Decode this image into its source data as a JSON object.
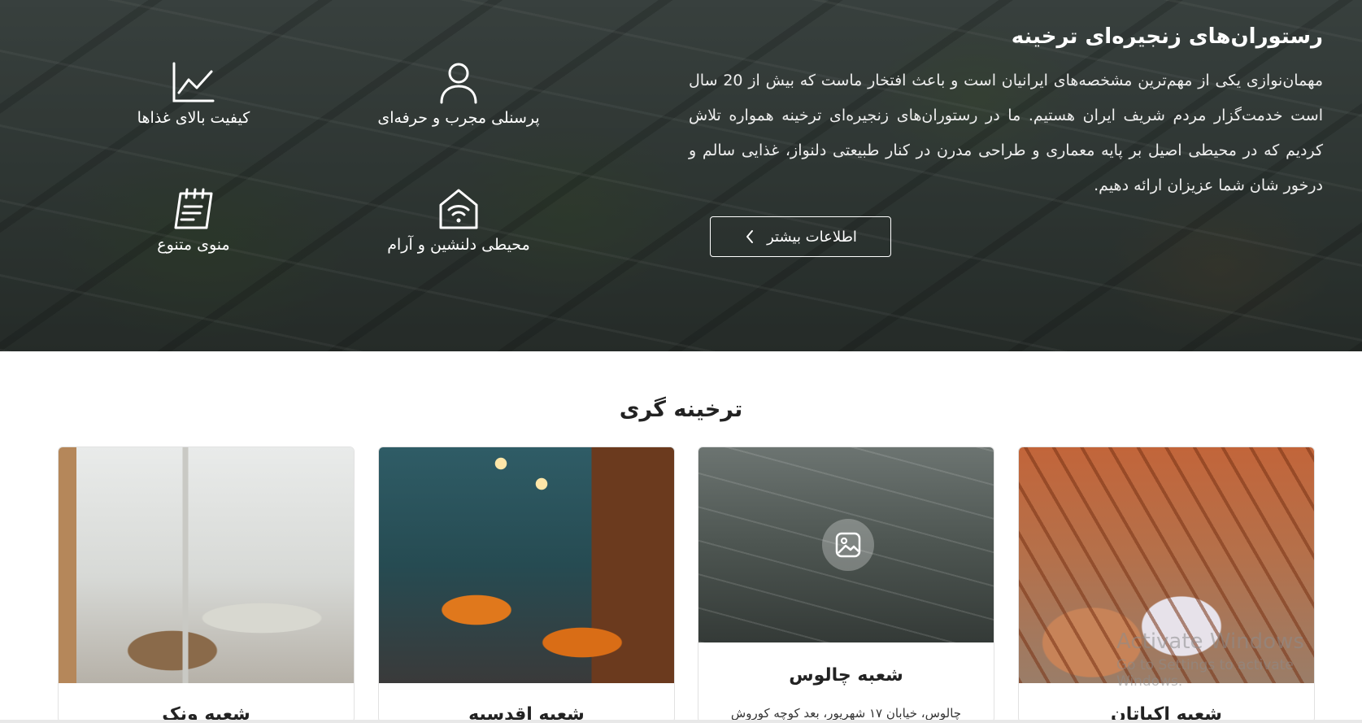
{
  "hero": {
    "title": "رستوران‌های زنجیره‌ای ترخینه",
    "description": "مهمان‌نوازی یکی از مهم‌ترین مشخصه‌های ایرانیان است و باعث افتخار ماست که بیش از 20 سال است خدمت‌گزار مردم شریف ایران هستیم. ما در رستوران‌های زنجیره‌ای ترخینه همواره تلاش کردیم که در محیطی اصیل بر پایه معماری و طراحی مدرن در کنار طبیعتی دلنواز، غذایی سالم و درخور شان شما عزیزان ارائه دهیم.",
    "more_button": "اطلاعات بیشتر",
    "features": [
      {
        "label": "پرسنلی مجرب و حرفه‌ای",
        "icon": "user-icon"
      },
      {
        "label": "کیفیت بالای غذاها",
        "icon": "chart-icon"
      },
      {
        "label": "محیطی دلنشین و آرام",
        "icon": "home-wifi-icon"
      },
      {
        "label": "منوی متنوع",
        "icon": "menu-note-icon"
      }
    ]
  },
  "branches": {
    "title": "ترخینه گری",
    "cards": [
      {
        "name": "شعبه اکباتان",
        "address": ""
      },
      {
        "name": "شعبه چالوس",
        "address": "چالوس، خیابان ۱۷ شهریور، بعد کوچه کوروش"
      },
      {
        "name": "شعبه اقدسیه",
        "address": ""
      },
      {
        "name": "شعبه ونک",
        "address": ""
      }
    ]
  },
  "watermark": {
    "line1": "Activate Windows",
    "line2": "Go to Settings to activate Windows."
  }
}
